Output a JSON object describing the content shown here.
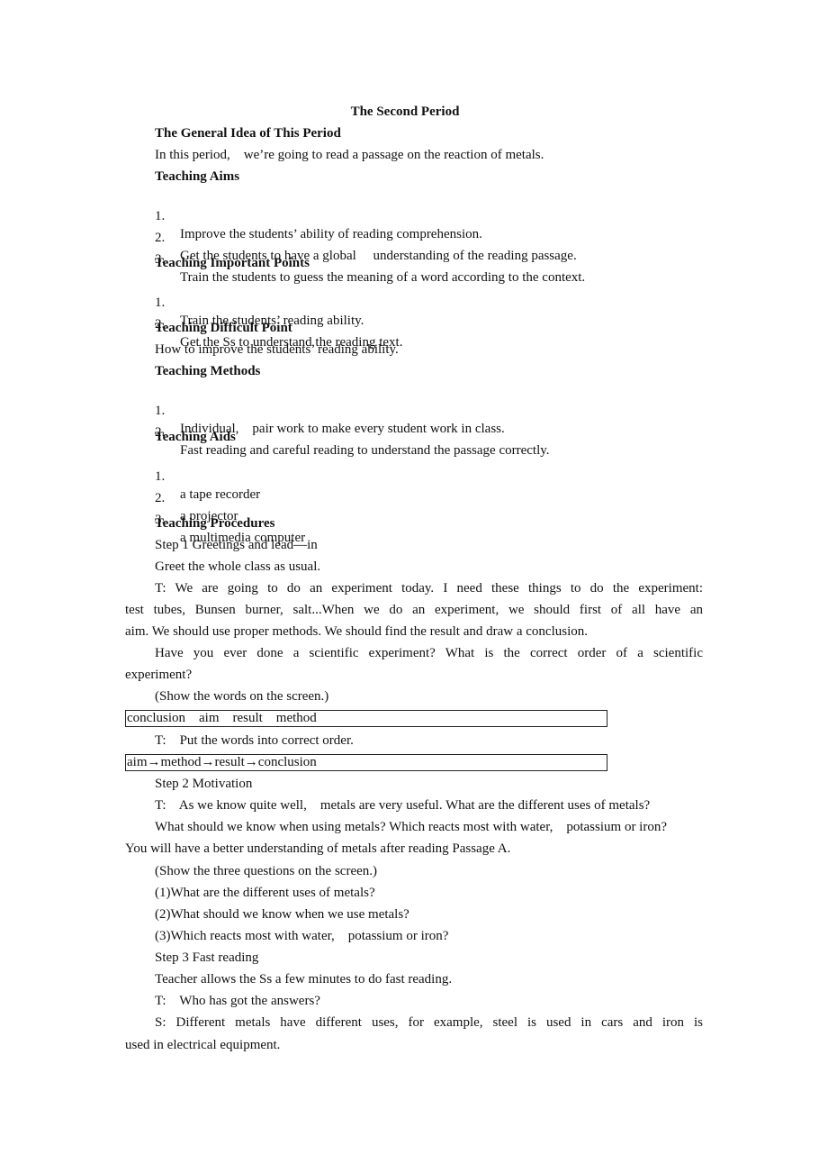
{
  "document": {
    "title": "The Second Period",
    "general_idea": {
      "heading": "The General Idea of This Period",
      "text": "In this period,    we’re going to read a passage on the reaction of metals."
    },
    "teaching_aims": {
      "heading": "Teaching Aims",
      "items": [
        {
          "num": "1.",
          "text": "Improve the students’ ability of reading comprehension."
        },
        {
          "num": "2.",
          "text": "Get the students to have a global     understanding of the reading passage."
        },
        {
          "num": "3.",
          "text": "Train the students to guess the meaning of a word according to the context."
        }
      ]
    },
    "important_points": {
      "heading": "Teaching Important Points",
      "items": [
        {
          "num": "1.",
          "text": "Train the students’ reading ability."
        },
        {
          "num": "2.",
          "text": "Get the Ss to understand the reading text."
        }
      ]
    },
    "difficult_point": {
      "heading": "Teaching Difficult Point",
      "text": "How to improve the students’ reading ability."
    },
    "methods": {
      "heading": "Teaching Methods",
      "items": [
        {
          "num": "1.",
          "text": "Individual,    pair work to make every student work in class."
        },
        {
          "num": "2.",
          "text": "Fast reading and careful reading to understand the passage correctly."
        }
      ]
    },
    "aids": {
      "heading": "Teaching Aids",
      "items": [
        {
          "num": "1.",
          "text": "a tape recorder"
        },
        {
          "num": "2.",
          "text": "a projector"
        },
        {
          "num": "3.",
          "text": "a multimedia computer"
        }
      ]
    },
    "procedures": {
      "heading": "Teaching Procedures",
      "step1_title": "Step 1 Greetings and lead—in",
      "step1_greet": "Greet the whole class as usual.",
      "p1_line1": "T:    We are going to do an experiment today.    I need these things to do the experiment:",
      "p1_line2": "test tubes,    Bunsen burner,    salt...When we do an experiment,    we should first of all have an",
      "p1_line3": "aim. We should use proper methods. We should find the result and draw a conclusion.",
      "p2_line1": "Have you ever done a scientific experiment? What is the correct order of a scientific",
      "p2_line2": "experiment?",
      "show_words": "(Show the words on the screen.)",
      "box1": "conclusion    aim    result    method",
      "put_order": "T:    Put the words into correct order.",
      "box2": "aim→method→result→conclusion",
      "step2_title": "Step 2 Motivation",
      "m_line1": "T:    As we know quite well,    metals are very useful. What are the different uses of metals?",
      "m_line2": "What should we know when using metals? Which reacts most with water,    potassium or iron?",
      "m_line3": "You will have a better understanding of metals after reading Passage A.",
      "show_questions": "(Show the three questions on the screen.)",
      "q1": "(1)What are the different uses of metals?",
      "q2": "(2)What should we know when we use metals?",
      "q3": "(3)Which reacts most with water,    potassium or iron?",
      "step3_title": "Step 3 Fast reading",
      "step3_text": "Teacher allows the Ss a few minutes to do fast reading.",
      "t_who": "T:    Who has got the answers?",
      "s_line1": "S:    Different metals have different uses,    for example,    steel is used in cars and iron is",
      "s_line2": "used in electrical equipment."
    }
  }
}
